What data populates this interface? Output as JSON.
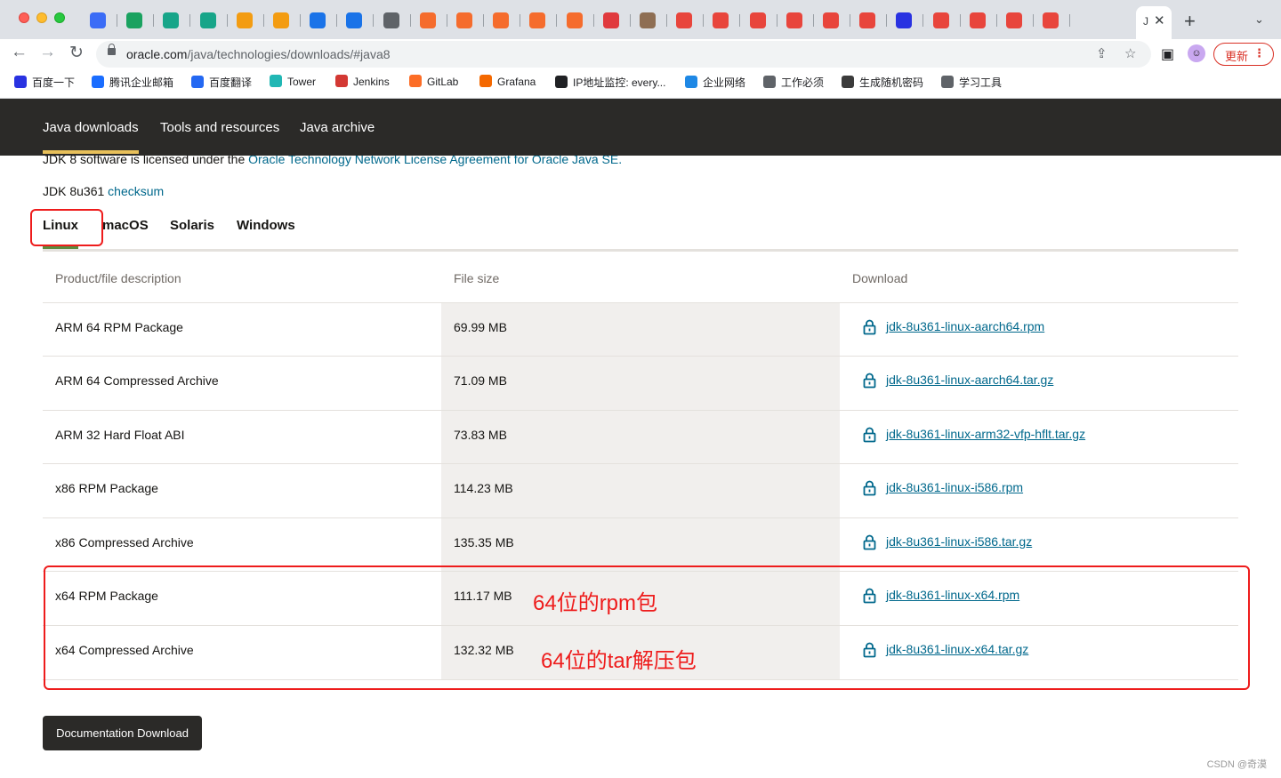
{
  "browser": {
    "active_tab_title": "J",
    "url_host": "oracle.com",
    "url_path": "/java/technologies/downloads/#java8",
    "update_label": "更新",
    "bookmarks": [
      {
        "label": "百度一下",
        "icon": "baidu-icon",
        "color": "#2932e1"
      },
      {
        "label": "腾讯企业邮箱",
        "icon": "tencent-mail-icon",
        "color": "#1a6dff"
      },
      {
        "label": "百度翻译",
        "icon": "baidu-translate-icon",
        "color": "#2468f2"
      },
      {
        "label": "Tower",
        "icon": "tower-icon",
        "color": "#21b7b4"
      },
      {
        "label": "Jenkins",
        "icon": "jenkins-icon",
        "color": "#d33833"
      },
      {
        "label": "GitLab",
        "icon": "gitlab-icon",
        "color": "#fc6d26"
      },
      {
        "label": "Grafana",
        "icon": "grafana-icon",
        "color": "#f46800"
      },
      {
        "label": "IP地址监控: every...",
        "icon": "globe-icon",
        "color": "#202124"
      },
      {
        "label": "企业网络",
        "icon": "tp-icon",
        "color": "#1e88e5"
      },
      {
        "label": "工作必须",
        "icon": "folder-icon",
        "color": "#5f6368"
      },
      {
        "label": "生成随机密码",
        "icon": "password-icon",
        "color": "#3b3b3b"
      },
      {
        "label": "学习工具",
        "icon": "folder-icon",
        "color": "#5f6368"
      }
    ]
  },
  "site_nav": {
    "items": [
      "Java downloads",
      "Tools and resources",
      "Java archive"
    ]
  },
  "license": {
    "prefix": "JDK 8 software is licensed under the ",
    "link": "Oracle Technology Network License Agreement for Oracle Java SE",
    "suffix": "."
  },
  "checksum": {
    "prefix": "JDK 8u361 ",
    "link": "checksum"
  },
  "os_tabs": [
    "Linux",
    "macOS",
    "Solaris",
    "Windows"
  ],
  "table": {
    "headers": [
      "Product/file description",
      "File size",
      "Download"
    ],
    "rows": [
      {
        "desc": "ARM 64 RPM Package",
        "size": "69.99 MB",
        "file": "jdk-8u361-linux-aarch64.rpm"
      },
      {
        "desc": "ARM 64 Compressed Archive",
        "size": "71.09 MB",
        "file": "jdk-8u361-linux-aarch64.tar.gz"
      },
      {
        "desc": "ARM 32 Hard Float ABI",
        "size": "73.83 MB",
        "file": "jdk-8u361-linux-arm32-vfp-hflt.tar.gz"
      },
      {
        "desc": "x86 RPM Package",
        "size": "114.23 MB",
        "file": "jdk-8u361-linux-i586.rpm"
      },
      {
        "desc": "x86 Compressed Archive",
        "size": "135.35 MB",
        "file": "jdk-8u361-linux-i586.tar.gz"
      },
      {
        "desc": "x64 RPM Package",
        "size": "111.17 MB",
        "file": "jdk-8u361-linux-x64.rpm"
      },
      {
        "desc": "x64 Compressed Archive",
        "size": "132.32 MB",
        "file": "jdk-8u361-linux-x64.tar.gz"
      }
    ]
  },
  "annotations": {
    "rpm_note": "64位的rpm包",
    "tar_note": "64位的tar解压包",
    "color": "#ee1c1c"
  },
  "doc_button": "Documentation Download",
  "watermark": "CSDN @奇漠"
}
